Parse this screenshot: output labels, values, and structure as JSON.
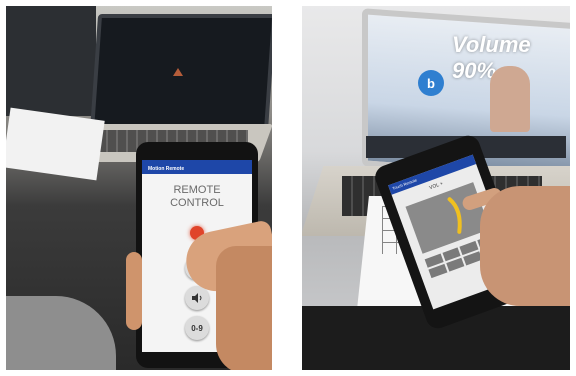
{
  "left_photo": {
    "app_bar_title": "Motion Remote",
    "remote_title_line1": "REMOTE",
    "remote_title_line2": "CONTROL",
    "buttons": {
      "ch": "CH",
      "volume_icon": "speaker-icon",
      "digits": "0-9"
    },
    "colors": {
      "app_bar": "#1e47a8",
      "power_glow": "#e0442a"
    }
  },
  "right_photo": {
    "screen_overlay_text": "Volume 90%",
    "logo_letter": "b",
    "phone_label": "VOL +",
    "app_bar_title": "Touch Remote",
    "colors": {
      "app_bar": "#1e47a8",
      "gesture": "#f0c020"
    }
  }
}
